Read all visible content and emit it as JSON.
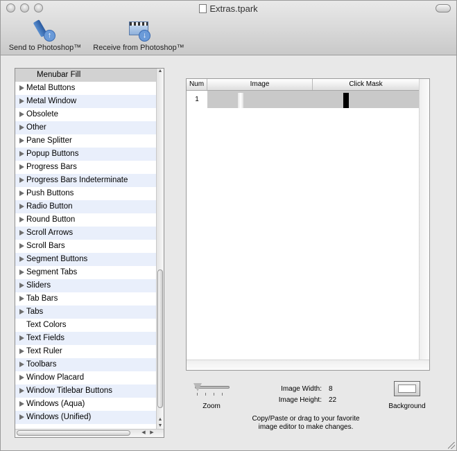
{
  "window": {
    "title": "Extras.tpark"
  },
  "toolbar": {
    "send_label": "Send to Photoshop™",
    "receive_label": "Receive from Photoshop™"
  },
  "sidebar": {
    "items": [
      {
        "label": "Menubar Fill",
        "expandable": false,
        "selected": true
      },
      {
        "label": "Metal Buttons",
        "expandable": true
      },
      {
        "label": "Metal Window",
        "expandable": true
      },
      {
        "label": "Obsolete",
        "expandable": true
      },
      {
        "label": "Other",
        "expandable": true
      },
      {
        "label": "Pane Splitter",
        "expandable": true
      },
      {
        "label": "Popup Buttons",
        "expandable": true
      },
      {
        "label": "Progress Bars",
        "expandable": true
      },
      {
        "label": "Progress Bars Indeterminate",
        "expandable": true
      },
      {
        "label": "Push Buttons",
        "expandable": true
      },
      {
        "label": "Radio Button",
        "expandable": true
      },
      {
        "label": "Round Button",
        "expandable": true
      },
      {
        "label": "Scroll Arrows",
        "expandable": true
      },
      {
        "label": "Scroll Bars",
        "expandable": true
      },
      {
        "label": "Segment Buttons",
        "expandable": true
      },
      {
        "label": "Segment Tabs",
        "expandable": true
      },
      {
        "label": "Sliders",
        "expandable": true
      },
      {
        "label": "Tab Bars",
        "expandable": true
      },
      {
        "label": "Tabs",
        "expandable": true
      },
      {
        "label": "Text Colors",
        "expandable": false
      },
      {
        "label": "Text Fields",
        "expandable": true
      },
      {
        "label": "Text Ruler",
        "expandable": true
      },
      {
        "label": "Toolbars",
        "expandable": true
      },
      {
        "label": "Window Placard",
        "expandable": true
      },
      {
        "label": "Window Titlebar Buttons",
        "expandable": true
      },
      {
        "label": "Windows (Aqua)",
        "expandable": true
      },
      {
        "label": "Windows (Unified)",
        "expandable": true
      }
    ]
  },
  "grid": {
    "columns": [
      "Num",
      "Image",
      "Click Mask"
    ],
    "rows": [
      {
        "num": "1"
      }
    ]
  },
  "footer": {
    "zoom_label": "Zoom",
    "width_label": "Image Width:",
    "width_value": "8",
    "height_label": "Image Height:",
    "height_value": "22",
    "hint_line1": "Copy/Paste or drag to your favorite",
    "hint_line2": "image editor to make changes.",
    "background_label": "Background"
  }
}
